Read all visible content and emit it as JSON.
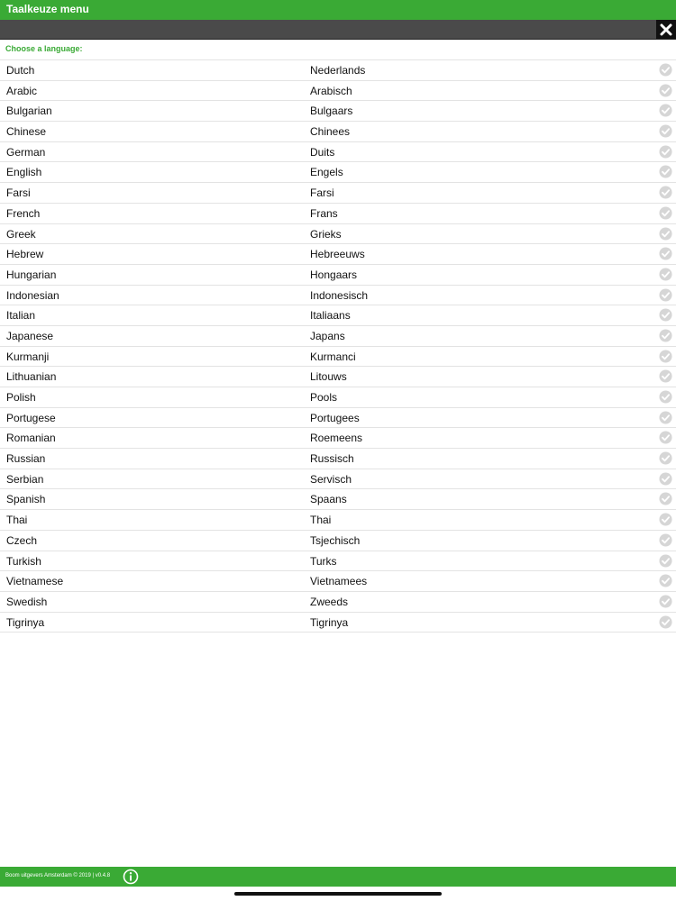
{
  "header": {
    "title": "Taalkeuze menu"
  },
  "prompt": "Choose a language:",
  "languages": [
    {
      "en": "Dutch",
      "nl": "Nederlands"
    },
    {
      "en": "Arabic",
      "nl": "Arabisch"
    },
    {
      "en": "Bulgarian",
      "nl": "Bulgaars"
    },
    {
      "en": "Chinese",
      "nl": "Chinees"
    },
    {
      "en": "German",
      "nl": "Duits"
    },
    {
      "en": "English",
      "nl": "Engels"
    },
    {
      "en": "Farsi",
      "nl": "Farsi"
    },
    {
      "en": "French",
      "nl": "Frans"
    },
    {
      "en": "Greek",
      "nl": "Grieks"
    },
    {
      "en": "Hebrew",
      "nl": "Hebreeuws"
    },
    {
      "en": "Hungarian",
      "nl": "Hongaars"
    },
    {
      "en": "Indonesian",
      "nl": "Indonesisch"
    },
    {
      "en": "Italian",
      "nl": "Italiaans"
    },
    {
      "en": "Japanese",
      "nl": "Japans"
    },
    {
      "en": "Kurmanji",
      "nl": "Kurmanci"
    },
    {
      "en": "Lithuanian",
      "nl": "Litouws"
    },
    {
      "en": "Polish",
      "nl": "Pools"
    },
    {
      "en": "Portugese",
      "nl": "Portugees"
    },
    {
      "en": "Romanian",
      "nl": "Roemeens"
    },
    {
      "en": "Russian",
      "nl": "Russisch"
    },
    {
      "en": "Serbian",
      "nl": "Servisch"
    },
    {
      "en": "Spanish",
      "nl": "Spaans"
    },
    {
      "en": "Thai",
      "nl": "Thai"
    },
    {
      "en": "Czech",
      "nl": "Tsjechisch"
    },
    {
      "en": "Turkish",
      "nl": "Turks"
    },
    {
      "en": "Vietnamese",
      "nl": "Vietnamees"
    },
    {
      "en": "Swedish",
      "nl": "Zweeds"
    },
    {
      "en": "Tigrinya",
      "nl": "Tigrinya"
    }
  ],
  "footer": {
    "copyright": "Boom uitgevers Amsterdam © 2019 | v0.4.8"
  },
  "icons": {
    "close": "close-icon",
    "check": "check-circle-icon",
    "info": "info-icon"
  },
  "colors": {
    "accent": "#3aaa35",
    "toolbar": "#4a4a4a",
    "check": "#d6d6d6"
  }
}
